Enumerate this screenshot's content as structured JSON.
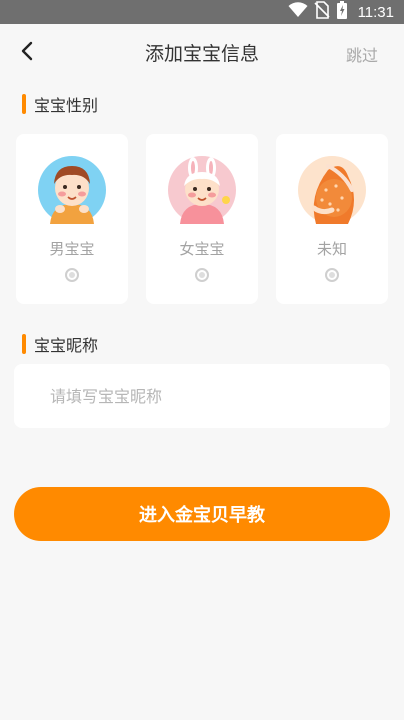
{
  "status_bar": {
    "time": "11:31",
    "icons": [
      "wifi-icon",
      "no-sim-icon",
      "battery-icon"
    ]
  },
  "header": {
    "title": "添加宝宝信息",
    "skip_label": "跳过",
    "back_icon": "chevron-left-icon"
  },
  "gender_section": {
    "title": "宝宝性别",
    "options": [
      {
        "label": "男宝宝",
        "icon": "boy-avatar-icon"
      },
      {
        "label": "女宝宝",
        "icon": "girl-avatar-icon"
      },
      {
        "label": "未知",
        "icon": "pregnant-belly-icon"
      }
    ]
  },
  "nickname_section": {
    "title": "宝宝昵称",
    "placeholder": "请填写宝宝昵称",
    "value": ""
  },
  "submit_label": "进入金宝贝早教",
  "colors": {
    "accent": "#ff8a00",
    "background": "#f7f7f7",
    "status_bar": "#6f6f6f"
  }
}
